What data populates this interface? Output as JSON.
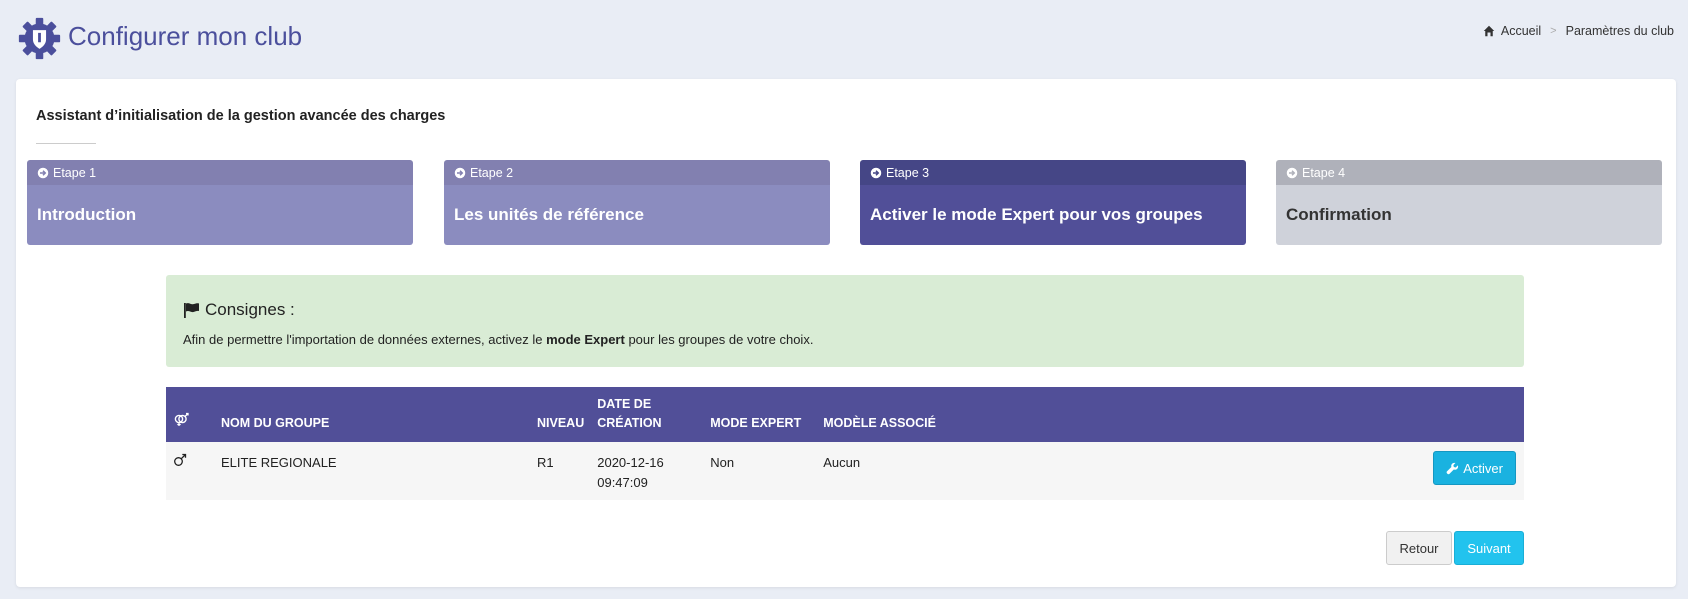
{
  "header": {
    "title": "Configurer mon club",
    "logo_icon": "gear-shield-icon",
    "brand_color": "#4b4f9c",
    "breadcrumb": {
      "home_icon": "home-icon",
      "home_label": "Accueil",
      "separator": ">",
      "current": "Paramètres du club"
    }
  },
  "wizard": {
    "title": "Assistant d’initialisation de la gestion avancée des charges",
    "steps": [
      {
        "label": "Etape 1",
        "title": "Introduction",
        "state": "done"
      },
      {
        "label": "Etape 2",
        "title": "Les unités de référence",
        "state": "done"
      },
      {
        "label": "Etape 3",
        "title": "Activer le mode Expert pour vos groupes",
        "state": "active"
      },
      {
        "label": "Etape 4",
        "title": "Confirmation",
        "state": "pending"
      }
    ]
  },
  "instructions": {
    "icon": "flag-icon",
    "title": "Consignes :",
    "text_before": "Afin de permettre l'importation de données externes, activez le ",
    "text_bold": "mode Expert",
    "text_after": " pour les groupes de votre choix."
  },
  "table": {
    "headers": {
      "gender_icon": "gender-icon",
      "name": "NOM DU GROUPE",
      "level": "NIVEAU",
      "created_line1": "DATE DE",
      "created_line2": "CRÉATION",
      "expert": "MODE EXPERT",
      "model": "MODÈLE ASSOCIÉ"
    },
    "rows": [
      {
        "gender_icon": "male-icon",
        "name": "ELITE REGIONALE",
        "level": "R1",
        "date": "2020-12-16",
        "time": "09:47:09",
        "expert": "Non",
        "model": "Aucun",
        "action_label": "Activer",
        "action_icon": "wrench-icon"
      }
    ]
  },
  "footer": {
    "back_label": "Retour",
    "next_label": "Suivant"
  }
}
